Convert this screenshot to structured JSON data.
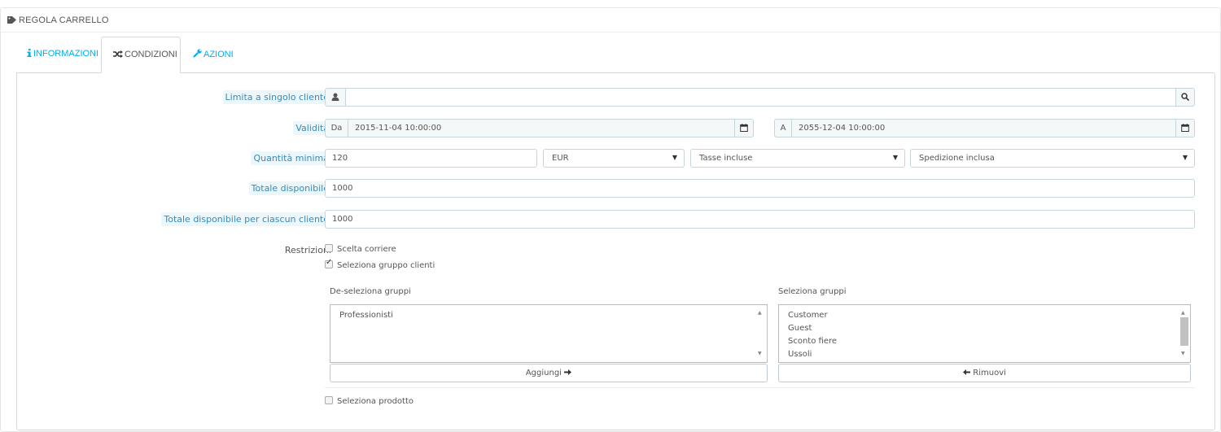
{
  "panel": {
    "title": "REGOLA CARRELLO",
    "icon": "tag-icon"
  },
  "tabs": [
    {
      "label": "INFORMAZIONI",
      "icon": "info-icon",
      "active": false
    },
    {
      "label": "CONDIZIONI",
      "icon": "shuffle-icon",
      "active": true
    },
    {
      "label": "AZIONI",
      "icon": "wrench-icon",
      "active": false
    }
  ],
  "form": {
    "customer": {
      "label": "Limita a singolo cliente",
      "value": "",
      "icon": "user-icon",
      "button_icon": "search-icon"
    },
    "validity": {
      "label": "Validità",
      "from_prefix": "Da",
      "from_value": "2015-11-04 10:00:00",
      "to_prefix": "A",
      "to_value": "2055-12-04 10:00:00",
      "icon": "calendar-icon"
    },
    "minimum": {
      "label": "Quantità minima",
      "amount": "120",
      "currency": "EUR",
      "tax": "Tasse incluse",
      "shipping": "Spedizione inclusa"
    },
    "total_available": {
      "label": "Totale disponibile",
      "value": "1000"
    },
    "total_per_customer": {
      "label": "Totale disponibile per ciascun cliente",
      "value": "1000"
    },
    "restrictions": {
      "label": "Restrizioni",
      "carrier": {
        "label": "Scelta corriere",
        "checked": false
      },
      "customer_group": {
        "label": "Seleziona gruppo clienti",
        "checked": true
      },
      "product": {
        "label": "Seleziona prodotto",
        "checked": false
      }
    },
    "groups": {
      "unselected_title": "De-seleziona gruppi",
      "unselected": [
        "Professionisti"
      ],
      "selected_title": "Seleziona gruppi",
      "selected": [
        "Customer",
        "Guest",
        "Sconto fiere",
        "Ussoli"
      ],
      "add_label": "Aggiungi",
      "remove_label": "Rimuovi"
    }
  }
}
